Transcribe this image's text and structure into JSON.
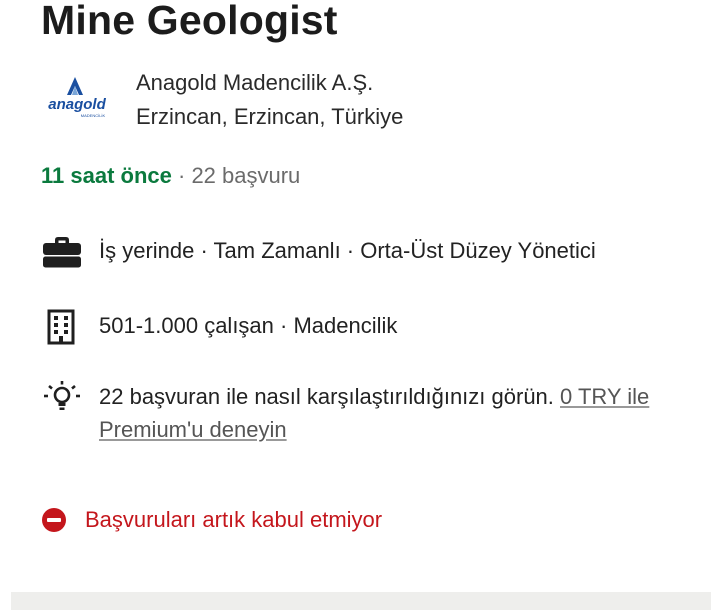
{
  "job": {
    "title": "Mine Geologist"
  },
  "company": {
    "logo_text": "anagold",
    "logo_subtext": "MADENCİLİK",
    "name": "Anagold Madencilik A.Ş.",
    "location": "Erzincan, Erzincan, Türkiye"
  },
  "meta": {
    "posted": "11 saat önce",
    "separator": " · ",
    "applicants": "22 başvuru"
  },
  "details": {
    "job_type": "İş yerinde · Tam Zamanlı · Orta-Üst Düzey Yönetici",
    "company_info": "501-1.000 çalışan · Madencilik",
    "premium_text": "22 başvuran ile nasıl karşılaştırıldığınızı görün. ",
    "premium_link": "0 TRY ile Premium'u deneyin"
  },
  "status": {
    "closed_text": "Başvuruları artık kabul etmiyor"
  },
  "colors": {
    "posted_green": "#0b7a3e",
    "closed_red": "#c4161c",
    "logo_blue": "#1a4fa0"
  }
}
